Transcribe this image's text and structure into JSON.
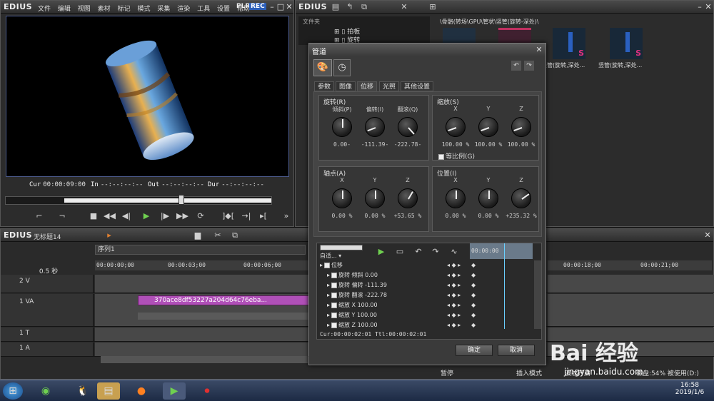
{
  "app": {
    "logo": "EDIUS",
    "menu": [
      "文件",
      "编辑",
      "视图",
      "素材",
      "标记",
      "模式",
      "采集",
      "渲染",
      "工具",
      "设置",
      "帮助"
    ],
    "plr": "PLR",
    "rec": "REC"
  },
  "player": {
    "cur_label": "Cur",
    "cur": "00:00:09:00",
    "in_label": "In",
    "in": "--:--:--:--",
    "out_label": "Out",
    "out": "--:--:--:--",
    "dur_label": "Dur",
    "dur": "--:--:--:--"
  },
  "bin": {
    "logo": "EDIUS",
    "folder_header": "文件夹",
    "tree": [
      "拍板",
      "旋转"
    ],
    "path": "\\骨骼(转场\\GPU\\管状\\竖管(旋转-深处)\\",
    "clips": [
      {
        "label": "",
        "color": "#203040"
      },
      {
        "label": "",
        "color": "#402030"
      },
      {
        "label": "竖管(旋转,深处...",
        "color": "#182838"
      },
      {
        "label": "竖管(旋转,深处...",
        "color": "#182838"
      },
      {
        "label": "竖管(旋转,深处...",
        "color": "#182838"
      }
    ]
  },
  "dialog": {
    "title": "管道",
    "tabs": [
      "参数",
      "图像",
      "位移",
      "光照",
      "其他设置"
    ],
    "rotation": {
      "title": "旋转(R)",
      "knobs": [
        {
          "label": "倾斜(P)",
          "value": "0.00-",
          "angle": 0
        },
        {
          "label": "偏转(I)",
          "value": "-111.39-",
          "angle": -111
        },
        {
          "label": "翻滚(Q)",
          "value": "-222.78-",
          "angle": -222
        }
      ]
    },
    "scale": {
      "title": "缩放(S)",
      "knobs": [
        {
          "label": "X",
          "value": "100.00 %",
          "angle": -110
        },
        {
          "label": "Y",
          "value": "100.00 %",
          "angle": -110
        },
        {
          "label": "Z",
          "value": "100.00 %",
          "angle": -110
        }
      ],
      "proportional": "等比例(G)"
    },
    "pivot": {
      "title": "轴点(A)",
      "knobs": [
        {
          "label": "X",
          "value": "0.00 %",
          "angle": 0
        },
        {
          "label": "Y",
          "value": "0.00 %",
          "angle": 0
        },
        {
          "label": "Z",
          "value": "+53.65 %",
          "angle": 30
        }
      ]
    },
    "position": {
      "title": "位置(I)",
      "knobs": [
        {
          "label": "X",
          "value": "0.00 %",
          "angle": 0
        },
        {
          "label": "Y",
          "value": "0.00 %",
          "angle": 0
        },
        {
          "label": "Z",
          "value": "+235.32 %",
          "angle": 55
        }
      ]
    },
    "auto_label": "自适...",
    "kf_timecode": "00:00:00",
    "tracks": [
      {
        "label": "位移",
        "value": ""
      },
      {
        "label": "旋转 倾斜",
        "value": "0.00"
      },
      {
        "label": "旋转 偏转",
        "value": "-111.39"
      },
      {
        "label": "旋转 翻滚",
        "value": "-222.78"
      },
      {
        "label": "缩放 X",
        "value": "100.00"
      },
      {
        "label": "缩放 Y",
        "value": "100.00"
      },
      {
        "label": "缩放 Z",
        "value": "100.00"
      }
    ],
    "status": "Cur:00:00:02:01  Ttl:00:00:02:01",
    "ok": "确定",
    "cancel": "取消"
  },
  "timeline": {
    "logo": "EDIUS",
    "project": "无标题14",
    "sequence": "序列1",
    "zoom": "0.5 秒",
    "ruler": [
      "00:00:00;00",
      "00:00:03;00",
      "00:00:06;00",
      "00:00:18;00",
      "00:00:21;00"
    ],
    "tracks": [
      {
        "name": "2 V"
      },
      {
        "name": "1 VA"
      },
      {
        "name": "1 T"
      },
      {
        "name": "1 A"
      }
    ],
    "clip_name": "370ace8df53227a204d64c76eba..."
  },
  "statusbar": {
    "pause": "暂停",
    "insert_mode": "插入模式",
    "ripple": "波纹开启",
    "disk": "磁盘:54% 被使用(D:)"
  },
  "taskbar": {
    "time": "16:58",
    "date": "2019/1/6"
  },
  "watermark": {
    "text": "Bai 经验",
    "url": "jingyan.baidu.com"
  }
}
